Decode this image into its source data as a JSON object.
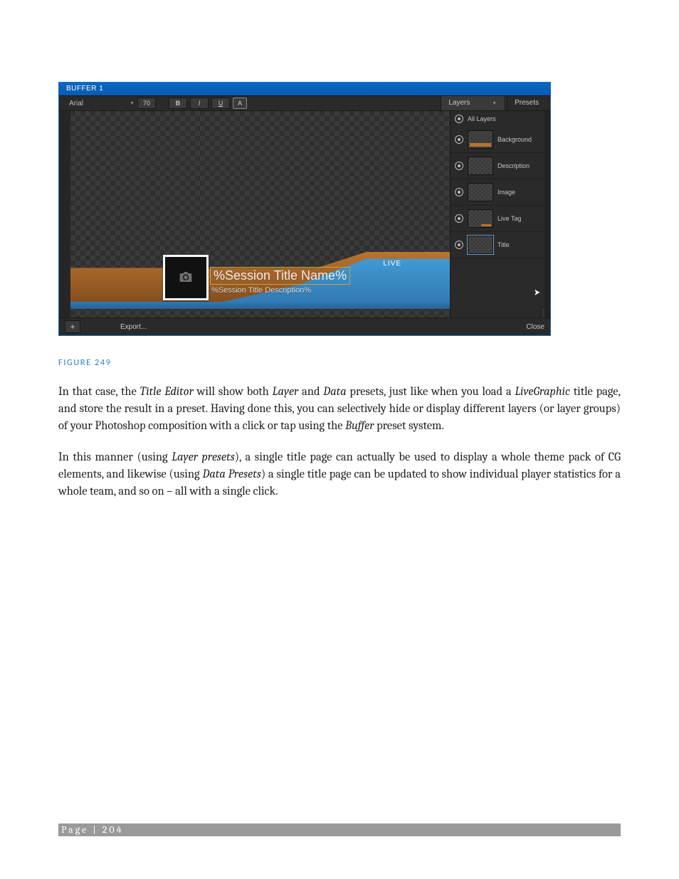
{
  "editor": {
    "window_title": "BUFFER 1",
    "toolbar": {
      "font_name": "Arial",
      "size_label": "70",
      "bold": "B",
      "italic": "I",
      "underline": "U",
      "boxed": "A",
      "layers_tab": "Layers",
      "presets_tab": "Presets"
    },
    "canvas": {
      "title_placeholder": "%Session Title Name%",
      "desc_placeholder": "%Session Title Description%",
      "live_tag": "LIVE"
    },
    "layers": {
      "all": "All Layers",
      "items": [
        "Background",
        "Description",
        "Image",
        "Live Tag",
        "Title"
      ]
    },
    "footer": {
      "export": "Export...",
      "close": "Close"
    }
  },
  "caption": "FIGURE 249",
  "paragraph1_parts": {
    "a": "In that case, the ",
    "b": "Title Editor",
    "c": " will show both ",
    "d": "Layer",
    "e": " and ",
    "f": "Data",
    "g": " presets, just like when you load a ",
    "h": "LiveGraphic",
    "i": " title page, and store the result in a preset. Having done this, you can selectively hide or display different layers (or layer groups) of your Photoshop composition with a click or tap using the ",
    "j": "Buffer",
    "k": " preset system."
  },
  "paragraph2_parts": {
    "a": "In this manner (using ",
    "b": "Layer presets",
    "c": "), a single title page can actually be used to display a whole theme pack of CG elements, and likewise (using ",
    "d": "Data Presets",
    "e": ") a single title page can be updated to show individual player statistics for a whole team, and so on – all with a single click."
  },
  "footer_text": "Page | 204"
}
